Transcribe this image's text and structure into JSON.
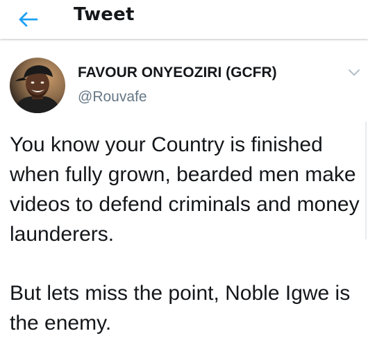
{
  "header": {
    "title": "Tweet",
    "back_icon": "arrow-left-icon",
    "accent_color": "#1da1f2"
  },
  "tweet": {
    "author": {
      "name": "FAVOUR ONYEOZIRI (GCFR)",
      "handle": "@Rouvafe"
    },
    "menu_icon": "chevron-down-icon",
    "paragraphs": [
      "You know your Country is finished when fully grown, bearded men make videos to defend criminals and money launderers.",
      "But lets miss the point, Noble Igwe is the enemy."
    ]
  }
}
